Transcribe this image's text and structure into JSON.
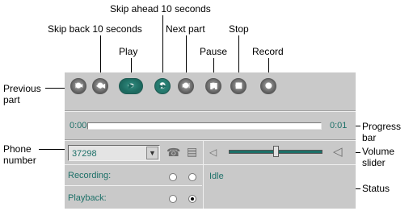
{
  "callouts": {
    "skip_ahead": "Skip ahead 10 seconds",
    "skip_back": "Skip back 10 seconds",
    "next_part": "Next part",
    "stop": "Stop",
    "play": "Play",
    "pause": "Pause",
    "record": "Record",
    "previous_part_1": "Previous",
    "previous_part_2": "part",
    "progress_bar_1": "Progress",
    "progress_bar_2": "bar",
    "phone_number_1": "Phone",
    "phone_number_2": "number",
    "volume_slider_1": "Volume",
    "volume_slider_2": "slider",
    "status": "Status"
  },
  "controls": {
    "buttons": [
      {
        "name": "previous-part",
        "icon": "skip-to-start-icon",
        "glyph": "|◀◀"
      },
      {
        "name": "skip-back",
        "icon": "rewind-icon",
        "glyph": "◀◀"
      },
      {
        "name": "play",
        "icon": "play-icon",
        "glyph": "▶"
      },
      {
        "name": "skip-ahead",
        "icon": "fast-forward-icon",
        "glyph": "▶▶"
      },
      {
        "name": "next-part",
        "icon": "skip-to-end-icon",
        "glyph": "▶▶|"
      },
      {
        "name": "pause",
        "icon": "pause-icon",
        "glyph": "❚❚"
      },
      {
        "name": "stop",
        "icon": "stop-icon",
        "glyph": "■"
      },
      {
        "name": "record",
        "icon": "record-icon",
        "glyph": "●"
      }
    ]
  },
  "progress": {
    "elapsed": "0:00",
    "total": "0:01",
    "fraction": 0
  },
  "phone": {
    "number": "37298",
    "dropdown_icon": "chevron-down-icon",
    "dial_icon": "telephone-icon",
    "device_icon": "monitor-icon"
  },
  "volume": {
    "low_icon": "speaker-low-icon",
    "high_icon": "speaker-high-icon",
    "level": 0.5
  },
  "modes": {
    "recording_label": "Recording:",
    "playback_label": "Playback:",
    "recording_selected": 0,
    "playback_selected": 1
  },
  "status": {
    "text": "Idle"
  },
  "colors": {
    "panel": "#c9c9c9",
    "accent": "#1d7068"
  }
}
